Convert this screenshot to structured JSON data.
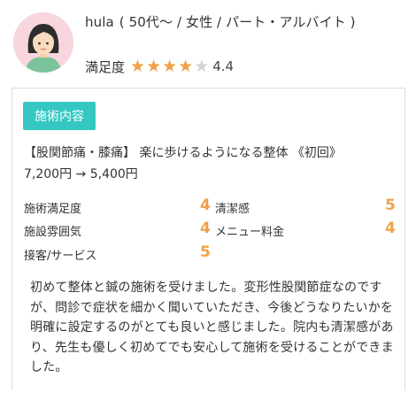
{
  "reviewer": {
    "name": "hula",
    "demographics": "( 50代〜 / 女性 / パート・アルバイト )",
    "avatar_icon": "female-user-avatar-icon"
  },
  "satisfaction": {
    "label": "満足度",
    "stars_filled": 4,
    "stars_total": 5,
    "score": "4.4",
    "star_color": "#f0a04a"
  },
  "treatment": {
    "badge": "施術内容",
    "badge_color": "#35c8c3",
    "menu_title": "【股関節痛・膝痛】 楽に歩けるようになる整体 《初回》",
    "price": "7,200円 → 5,400円"
  },
  "ratings": [
    {
      "label": "施術満足度",
      "value": "4"
    },
    {
      "label": "清潔感",
      "value": "5"
    },
    {
      "label": "施設雰囲気",
      "value": "4"
    },
    {
      "label": "メニュー料金",
      "value": "4"
    },
    {
      "label": "接客/サービス",
      "value": "5"
    }
  ],
  "comment": "初めて整体と鍼の施術を受けました。変形性股関節症なのですが、問診で症状を細かく聞いていただき、今後どうなりたいかを明確に設定するのがとても良いと感じました。院内も清潔感があり、先生も優しく初めてでも安心して施術を受けることができました。"
}
